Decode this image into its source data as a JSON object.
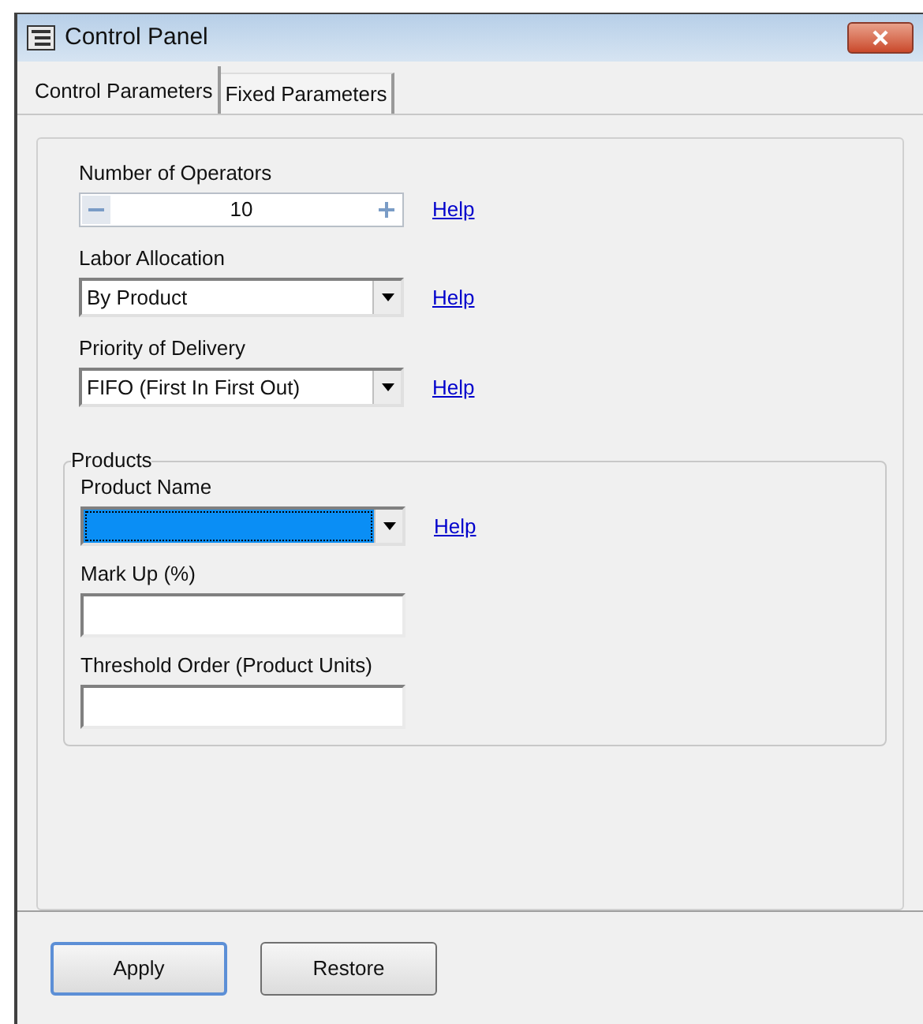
{
  "window": {
    "title": "Control Panel"
  },
  "tabs": [
    {
      "label": "Control Parameters",
      "selected": true
    },
    {
      "label": "Fixed Parameters",
      "selected": false
    }
  ],
  "fields": [
    {
      "kind": "spinner",
      "label": "Number of Operators",
      "value": "10",
      "help": "Help"
    },
    {
      "kind": "dropdown",
      "label": "Labor Allocation",
      "value": "By Product",
      "help": "Help"
    },
    {
      "kind": "dropdown",
      "label": "Priority of Delivery",
      "value": "FIFO (First In First Out)",
      "help": "Help"
    }
  ],
  "products": {
    "title": "Products",
    "fields": [
      {
        "kind": "dropdown",
        "label": "Product Name",
        "focused": true,
        "help": "Help"
      },
      {
        "kind": "text",
        "label": "Mark Up (%)"
      },
      {
        "kind": "text",
        "label": "Threshold Order (Product Units)"
      }
    ]
  },
  "buttons": [
    {
      "label": "Apply",
      "default": true
    },
    {
      "label": "Restore",
      "default": false
    }
  ]
}
